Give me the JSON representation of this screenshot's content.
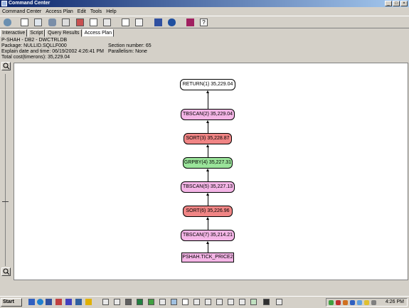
{
  "window": {
    "title": "Command Center"
  },
  "menu": [
    "Command Center",
    "Access Plan",
    "Edit",
    "Tools",
    "Help"
  ],
  "tabs": [
    {
      "label": "Interactive",
      "active": false
    },
    {
      "label": "Script",
      "active": false
    },
    {
      "label": "Query Results",
      "active": false
    },
    {
      "label": "Access Plan",
      "active": true
    }
  ],
  "info": {
    "line1": "P-SHAH - DB2 - DWCTRLDB",
    "package": "Package: NULLID.SQLLF000",
    "section": "Section number: 65",
    "explain": "Explain date and time: 06/19/2002 4:26:41 PM",
    "parallelism": "Parallelism: None",
    "total_cost": "Total cost(timerons): 35,229.04"
  },
  "plan_nodes": [
    {
      "label": "RETURN(1) 35,229.04",
      "color": "#ffffff"
    },
    {
      "label": "TBSCAN(2) 35,229.04",
      "color": "#f4b5e6"
    },
    {
      "label": "SORT(3) 35,228.87",
      "color": "#f08585"
    },
    {
      "label": "GRPBY(4) 35,227.31",
      "color": "#9ae49a"
    },
    {
      "label": "TBSCAN(5) 35,227.13",
      "color": "#f4b5e6"
    },
    {
      "label": "SORT(6) 35,226.96",
      "color": "#f08585"
    },
    {
      "label": "TBSCAN(7) 35,214.21",
      "color": "#f4b5e6"
    },
    {
      "label": "PSHAH.TICK_PRICE2",
      "color": "#f4b5e6"
    }
  ],
  "taskbar": {
    "start_label": "Start",
    "clock": "4:26 PM"
  }
}
